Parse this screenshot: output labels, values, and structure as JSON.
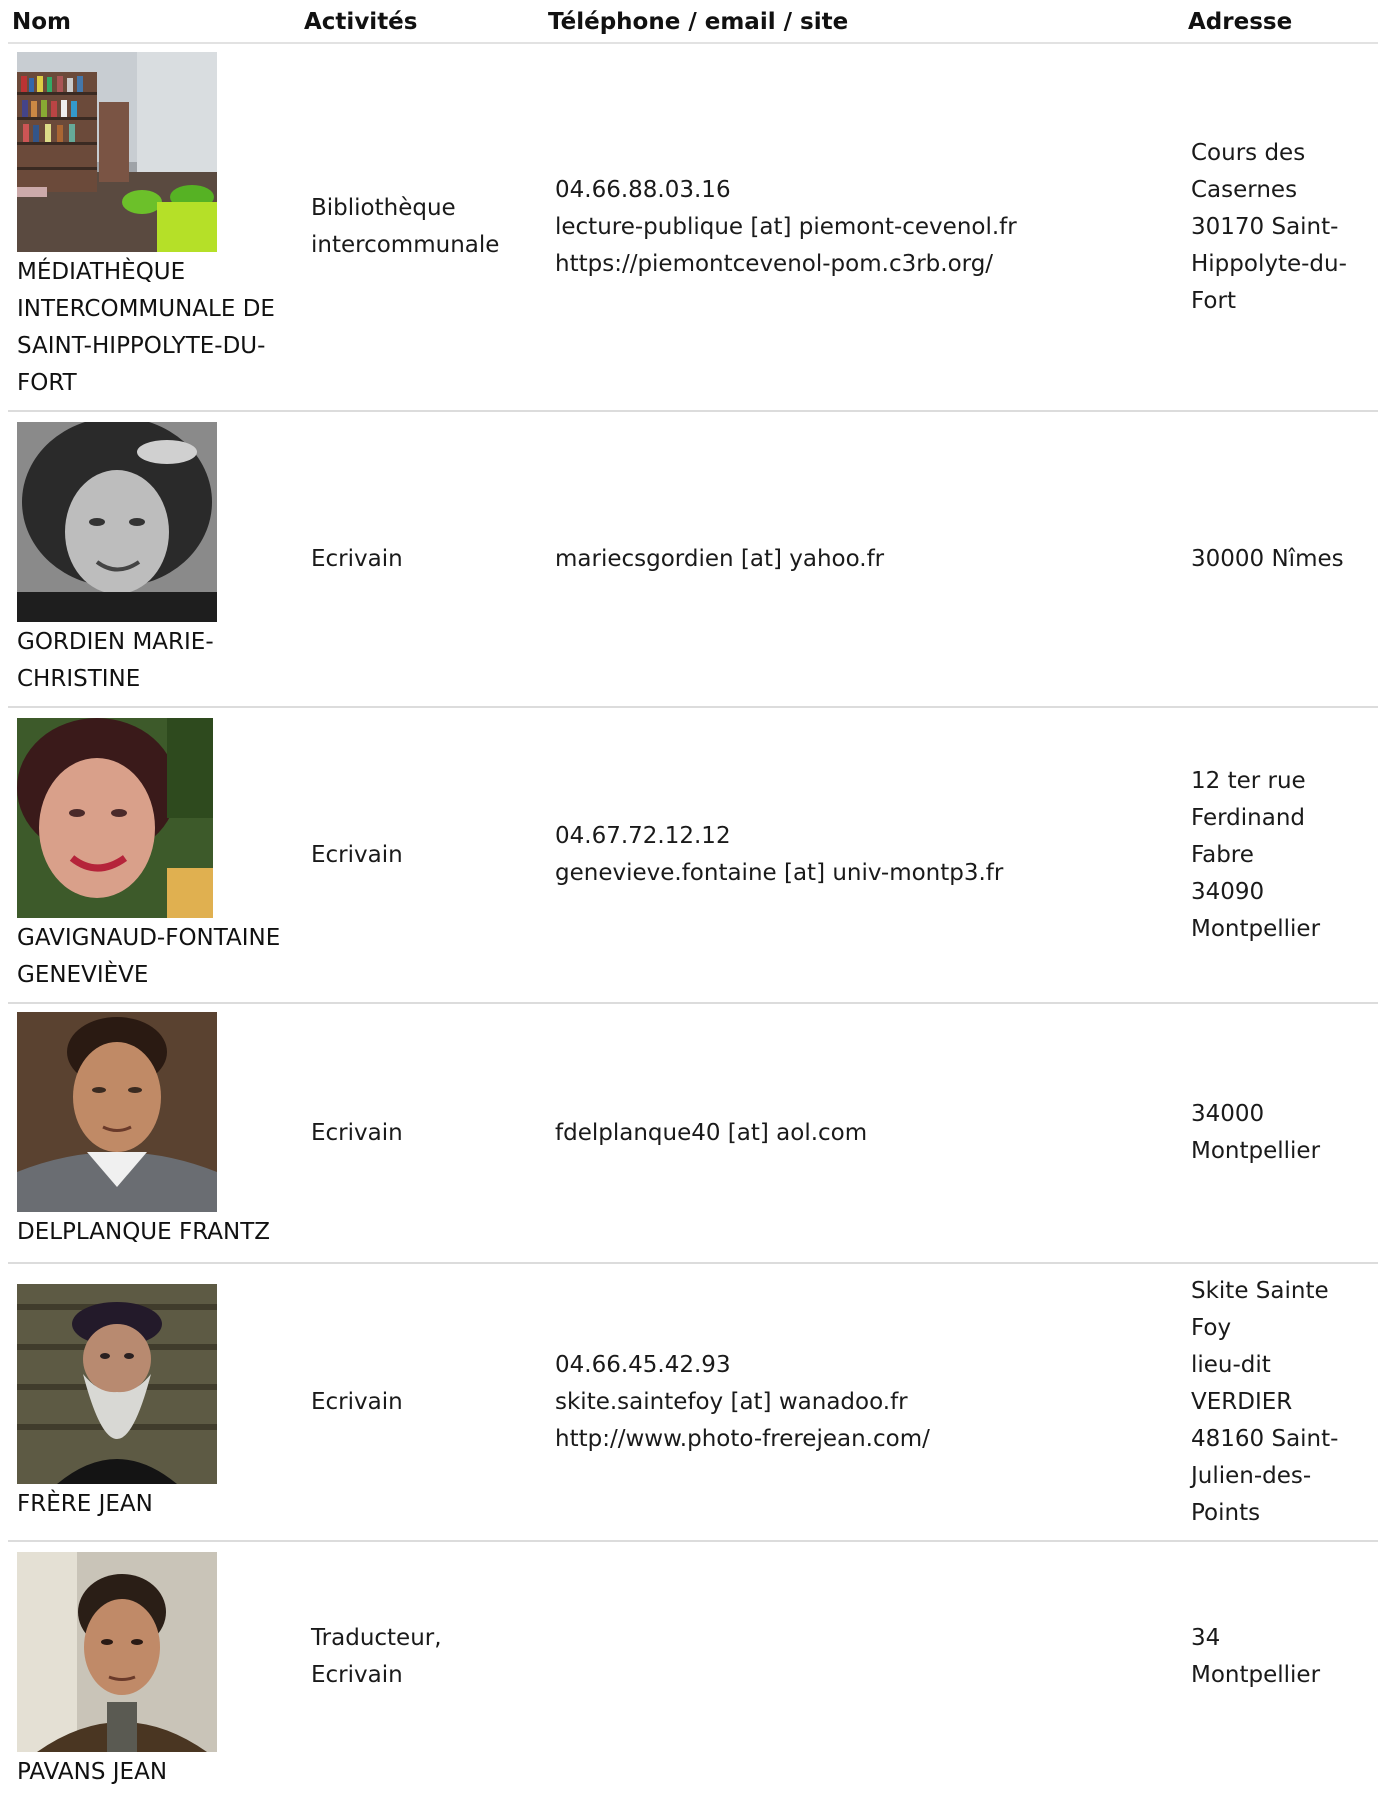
{
  "header": {
    "nom": "Nom",
    "activites": "Activités",
    "contact": "Téléphone / email / site",
    "adresse": "Adresse"
  },
  "rows": [
    {
      "name": "MÉDIATHÈQUE INTERCOMMUNALE DE SAINT-HIPPOLYTE-DU-FORT",
      "photo_alt": "library-interior-photo",
      "activity": [
        "Bibliothèque",
        "intercommunale"
      ],
      "contact": [
        "04.66.88.03.16",
        "lecture-publique [at] piemont-cevenol.fr",
        "https://piemontcevenol-pom.c3rb.org/"
      ],
      "address": [
        "Cours des",
        "Casernes",
        "30170 Saint-",
        "Hippolyte-du-",
        "Fort"
      ]
    },
    {
      "name": "GORDIEN MARIE-CHRISTINE",
      "photo_alt": "portrait-photo",
      "activity": [
        "Ecrivain"
      ],
      "contact": [
        "mariecsgordien [at] yahoo.fr"
      ],
      "address": [
        "30000 Nîmes"
      ]
    },
    {
      "name": "GAVIGNAUD-FONTAINE GENEVIÈVE",
      "photo_alt": "portrait-photo",
      "activity": [
        "Ecrivain"
      ],
      "contact": [
        "04.67.72.12.12",
        "genevieve.fontaine [at] univ-montp3.fr"
      ],
      "address": [
        "12 ter rue",
        "Ferdinand",
        "Fabre",
        "34090",
        "Montpellier"
      ]
    },
    {
      "name": "DELPLANQUE FRANTZ",
      "photo_alt": "portrait-photo",
      "activity": [
        "Ecrivain"
      ],
      "contact": [
        "fdelplanque40 [at] aol.com"
      ],
      "address": [
        "34000",
        "Montpellier"
      ]
    },
    {
      "name": "FRÈRE JEAN",
      "photo_alt": "portrait-photo",
      "activity": [
        "Ecrivain"
      ],
      "contact": [
        "04.66.45.42.93",
        "skite.saintefoy [at] wanadoo.fr",
        "http://www.photo-frerejean.com/"
      ],
      "address": [
        "Skite Sainte",
        "Foy",
        "lieu-dit",
        "VERDIER",
        "48160 Saint-",
        "Julien-des-",
        "Points"
      ]
    },
    {
      "name": "PAVANS JEAN",
      "photo_alt": "portrait-photo",
      "activity": [
        "Traducteur,",
        "Ecrivain"
      ],
      "contact": [],
      "address": [
        "34",
        "Montpellier"
      ]
    }
  ]
}
